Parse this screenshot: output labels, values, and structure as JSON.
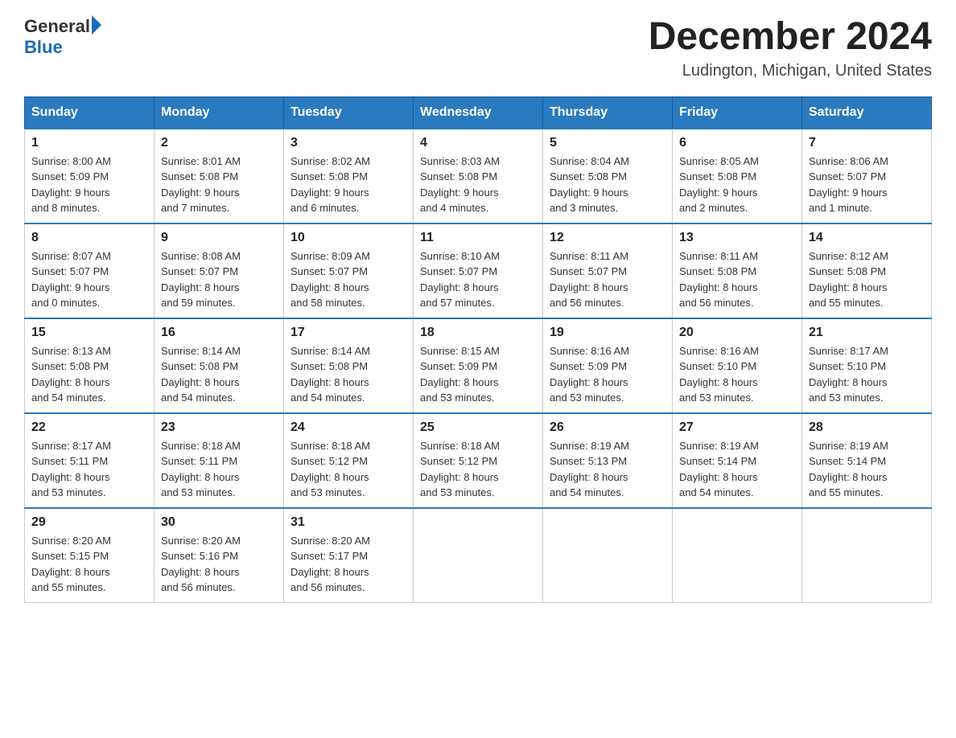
{
  "header": {
    "logo_text_general": "General",
    "logo_text_blue": "Blue",
    "main_title": "December 2024",
    "subtitle": "Ludington, Michigan, United States"
  },
  "calendar": {
    "days_of_week": [
      "Sunday",
      "Monday",
      "Tuesday",
      "Wednesday",
      "Thursday",
      "Friday",
      "Saturday"
    ],
    "weeks": [
      [
        {
          "day": "1",
          "info": "Sunrise: 8:00 AM\nSunset: 5:09 PM\nDaylight: 9 hours\nand 8 minutes."
        },
        {
          "day": "2",
          "info": "Sunrise: 8:01 AM\nSunset: 5:08 PM\nDaylight: 9 hours\nand 7 minutes."
        },
        {
          "day": "3",
          "info": "Sunrise: 8:02 AM\nSunset: 5:08 PM\nDaylight: 9 hours\nand 6 minutes."
        },
        {
          "day": "4",
          "info": "Sunrise: 8:03 AM\nSunset: 5:08 PM\nDaylight: 9 hours\nand 4 minutes."
        },
        {
          "day": "5",
          "info": "Sunrise: 8:04 AM\nSunset: 5:08 PM\nDaylight: 9 hours\nand 3 minutes."
        },
        {
          "day": "6",
          "info": "Sunrise: 8:05 AM\nSunset: 5:08 PM\nDaylight: 9 hours\nand 2 minutes."
        },
        {
          "day": "7",
          "info": "Sunrise: 8:06 AM\nSunset: 5:07 PM\nDaylight: 9 hours\nand 1 minute."
        }
      ],
      [
        {
          "day": "8",
          "info": "Sunrise: 8:07 AM\nSunset: 5:07 PM\nDaylight: 9 hours\nand 0 minutes."
        },
        {
          "day": "9",
          "info": "Sunrise: 8:08 AM\nSunset: 5:07 PM\nDaylight: 8 hours\nand 59 minutes."
        },
        {
          "day": "10",
          "info": "Sunrise: 8:09 AM\nSunset: 5:07 PM\nDaylight: 8 hours\nand 58 minutes."
        },
        {
          "day": "11",
          "info": "Sunrise: 8:10 AM\nSunset: 5:07 PM\nDaylight: 8 hours\nand 57 minutes."
        },
        {
          "day": "12",
          "info": "Sunrise: 8:11 AM\nSunset: 5:07 PM\nDaylight: 8 hours\nand 56 minutes."
        },
        {
          "day": "13",
          "info": "Sunrise: 8:11 AM\nSunset: 5:08 PM\nDaylight: 8 hours\nand 56 minutes."
        },
        {
          "day": "14",
          "info": "Sunrise: 8:12 AM\nSunset: 5:08 PM\nDaylight: 8 hours\nand 55 minutes."
        }
      ],
      [
        {
          "day": "15",
          "info": "Sunrise: 8:13 AM\nSunset: 5:08 PM\nDaylight: 8 hours\nand 54 minutes."
        },
        {
          "day": "16",
          "info": "Sunrise: 8:14 AM\nSunset: 5:08 PM\nDaylight: 8 hours\nand 54 minutes."
        },
        {
          "day": "17",
          "info": "Sunrise: 8:14 AM\nSunset: 5:08 PM\nDaylight: 8 hours\nand 54 minutes."
        },
        {
          "day": "18",
          "info": "Sunrise: 8:15 AM\nSunset: 5:09 PM\nDaylight: 8 hours\nand 53 minutes."
        },
        {
          "day": "19",
          "info": "Sunrise: 8:16 AM\nSunset: 5:09 PM\nDaylight: 8 hours\nand 53 minutes."
        },
        {
          "day": "20",
          "info": "Sunrise: 8:16 AM\nSunset: 5:10 PM\nDaylight: 8 hours\nand 53 minutes."
        },
        {
          "day": "21",
          "info": "Sunrise: 8:17 AM\nSunset: 5:10 PM\nDaylight: 8 hours\nand 53 minutes."
        }
      ],
      [
        {
          "day": "22",
          "info": "Sunrise: 8:17 AM\nSunset: 5:11 PM\nDaylight: 8 hours\nand 53 minutes."
        },
        {
          "day": "23",
          "info": "Sunrise: 8:18 AM\nSunset: 5:11 PM\nDaylight: 8 hours\nand 53 minutes."
        },
        {
          "day": "24",
          "info": "Sunrise: 8:18 AM\nSunset: 5:12 PM\nDaylight: 8 hours\nand 53 minutes."
        },
        {
          "day": "25",
          "info": "Sunrise: 8:18 AM\nSunset: 5:12 PM\nDaylight: 8 hours\nand 53 minutes."
        },
        {
          "day": "26",
          "info": "Sunrise: 8:19 AM\nSunset: 5:13 PM\nDaylight: 8 hours\nand 54 minutes."
        },
        {
          "day": "27",
          "info": "Sunrise: 8:19 AM\nSunset: 5:14 PM\nDaylight: 8 hours\nand 54 minutes."
        },
        {
          "day": "28",
          "info": "Sunrise: 8:19 AM\nSunset: 5:14 PM\nDaylight: 8 hours\nand 55 minutes."
        }
      ],
      [
        {
          "day": "29",
          "info": "Sunrise: 8:20 AM\nSunset: 5:15 PM\nDaylight: 8 hours\nand 55 minutes."
        },
        {
          "day": "30",
          "info": "Sunrise: 8:20 AM\nSunset: 5:16 PM\nDaylight: 8 hours\nand 56 minutes."
        },
        {
          "day": "31",
          "info": "Sunrise: 8:20 AM\nSunset: 5:17 PM\nDaylight: 8 hours\nand 56 minutes."
        },
        {
          "day": "",
          "info": ""
        },
        {
          "day": "",
          "info": ""
        },
        {
          "day": "",
          "info": ""
        },
        {
          "day": "",
          "info": ""
        }
      ]
    ]
  }
}
